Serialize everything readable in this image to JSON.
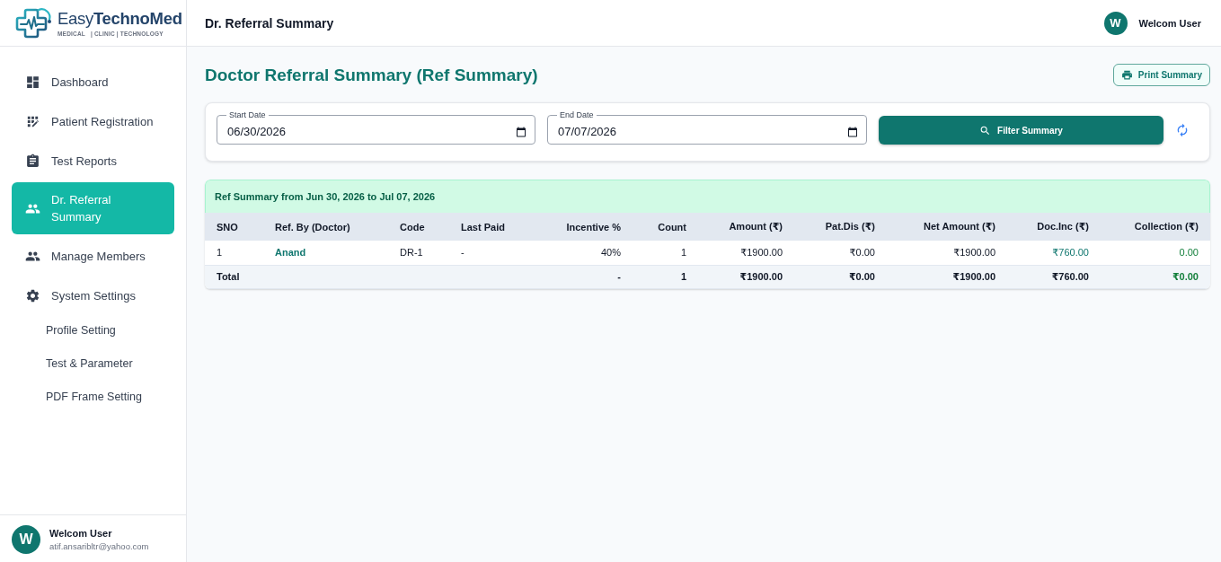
{
  "brand": {
    "name": "Easy**TechnoMed**",
    "tagline": "MEDICAL   | CLINIC | TECHNOLOGY"
  },
  "sidebar": {
    "items": [
      {
        "label": "Dashboard",
        "selected": false
      },
      {
        "label": "Patient Registration",
        "selected": false
      },
      {
        "label": "Test Reports",
        "selected": false
      },
      {
        "label": "Dr. Referral Summary",
        "selected": true
      },
      {
        "label": "Manage Members",
        "selected": false
      },
      {
        "label": "System Settings",
        "selected": false,
        "children": [
          {
            "label": "Profile Setting",
            "selected": false
          },
          {
            "label": "Test & Parameter",
            "selected": false
          },
          {
            "label": "PDF Frame Setting",
            "selected": false
          }
        ]
      }
    ],
    "user": {
      "initial": "W",
      "name": "Welcom User",
      "email": "atif.ansaribltr@yahoo.com"
    }
  },
  "header": {
    "title": "Dr. Referral Summary",
    "user": {
      "initial": "W",
      "name": "Welcom User"
    }
  },
  "page": {
    "title": "Doctor Referral Summary (Ref Summary)",
    "print_button": "Print Summary",
    "filters": {
      "start_date": {
        "label": "Start Date",
        "value": "06/30/2026"
      },
      "end_date": {
        "label": "End Date",
        "value": "07/07/2026"
      },
      "filter_button": "Filter Summary"
    },
    "summary": {
      "caption": "Ref Summary from Jun 30, 2026 to Jul 07, 2026",
      "table": {
        "columns": [
          "SNO",
          "Ref. By (Doctor)",
          "Code",
          "Last Paid",
          "Incentive %",
          "Count",
          "Amount (₹)",
          "Pat.Dis (₹)",
          "Net Amount (₹)",
          "Doc.Inc (₹)",
          "Collection (₹)"
        ],
        "rows": [
          [
            "1",
            "Anand",
            "DR-1",
            "-",
            "40%",
            "1",
            "₹1900.00",
            "₹0.00",
            "₹1900.00",
            "₹760.00",
            "0.00"
          ]
        ],
        "total": {
          "label": "Total",
          "values": [
            "-",
            "1",
            "₹1900.00",
            "₹0.00",
            "₹1900.00",
            "₹760.00",
            "₹0.00"
          ]
        }
      }
    }
  }
}
